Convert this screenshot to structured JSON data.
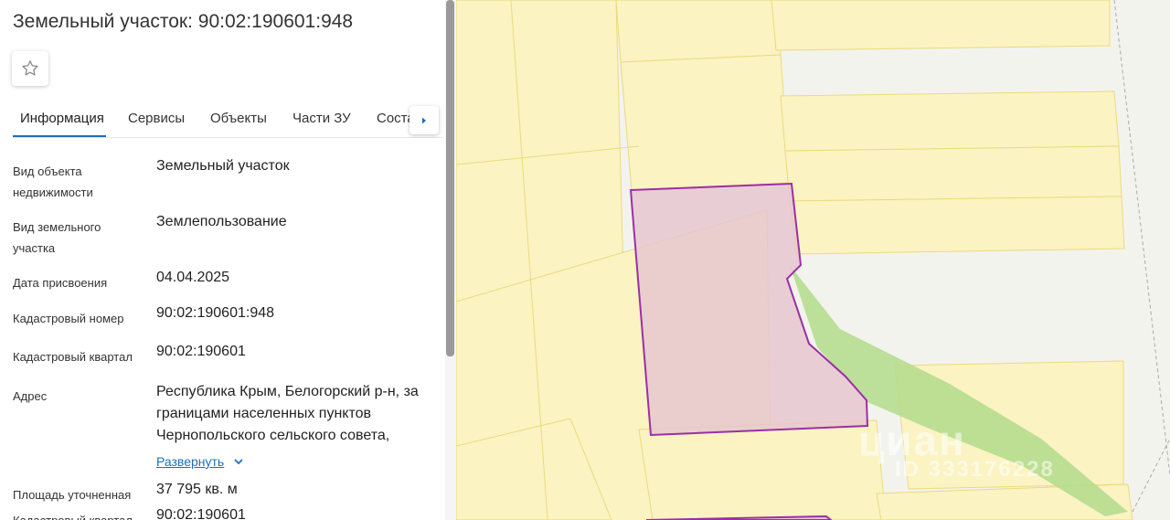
{
  "title": "Земельный участок: 90:02:190601:948",
  "tabs": [
    {
      "label": "Информация"
    },
    {
      "label": "Сервисы"
    },
    {
      "label": "Объекты"
    },
    {
      "label": "Части ЗУ"
    },
    {
      "label": "Соста"
    }
  ],
  "details": [
    {
      "label": "Вид объекта недвижимости",
      "value": "Земельный участок"
    },
    {
      "label": "Вид земельного участка",
      "value": "Землепользование"
    },
    {
      "label": "Дата присвоения",
      "value": "04.04.2025"
    },
    {
      "label": "Кадастровый номер",
      "value": "90:02:190601:948"
    },
    {
      "label": "Кадастровый квартал",
      "value": "90:02:190601"
    },
    {
      "label": "Адрес",
      "value": "Республика Крым, Белогорский р-н, за границами населенных пунктов Чернопольского сельского совета,"
    },
    {
      "label": "Площадь уточненная",
      "value": "37 795 кв. м"
    },
    {
      "label": "Кадастровый квартал",
      "value": "90:02:190601"
    }
  ],
  "expand_label": "Развернуть",
  "watermark": {
    "brand": "циан",
    "id": "ID 333176228"
  },
  "colors": {
    "accent": "#1d6fbf",
    "parcel_fill": "#e6c6cf",
    "parcel_stroke": "#9b2fa6",
    "map_yellow": "#fbf3c2",
    "map_green": "#b6dd8f"
  },
  "icons": {
    "favorite": "star-outline-icon",
    "tabs_next": "chevron-right-icon",
    "expand": "chevron-down-icon"
  }
}
